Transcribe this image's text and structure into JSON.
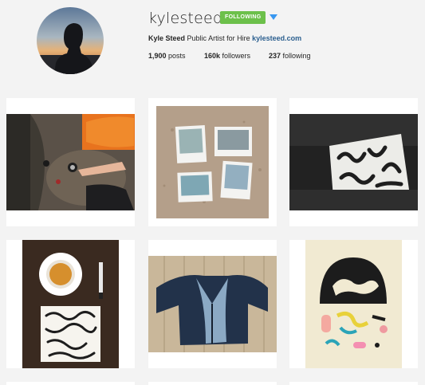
{
  "profile": {
    "username": "kylesteed",
    "follow_button": "FOLLOWING",
    "full_name": "Kyle Steed",
    "bio": "Public Artist for Hire",
    "website": "kylesteed.com"
  },
  "stats": {
    "posts_count": "1,900",
    "posts_label": "posts",
    "followers_count": "160k",
    "followers_label": "followers",
    "following_count": "237",
    "following_label": "following"
  },
  "icons": {
    "dropdown": "caret-down-icon"
  },
  "colors": {
    "following_button": "#6cc04a",
    "dropdown_caret": "#3897f0",
    "link": "#2b5f8f"
  }
}
